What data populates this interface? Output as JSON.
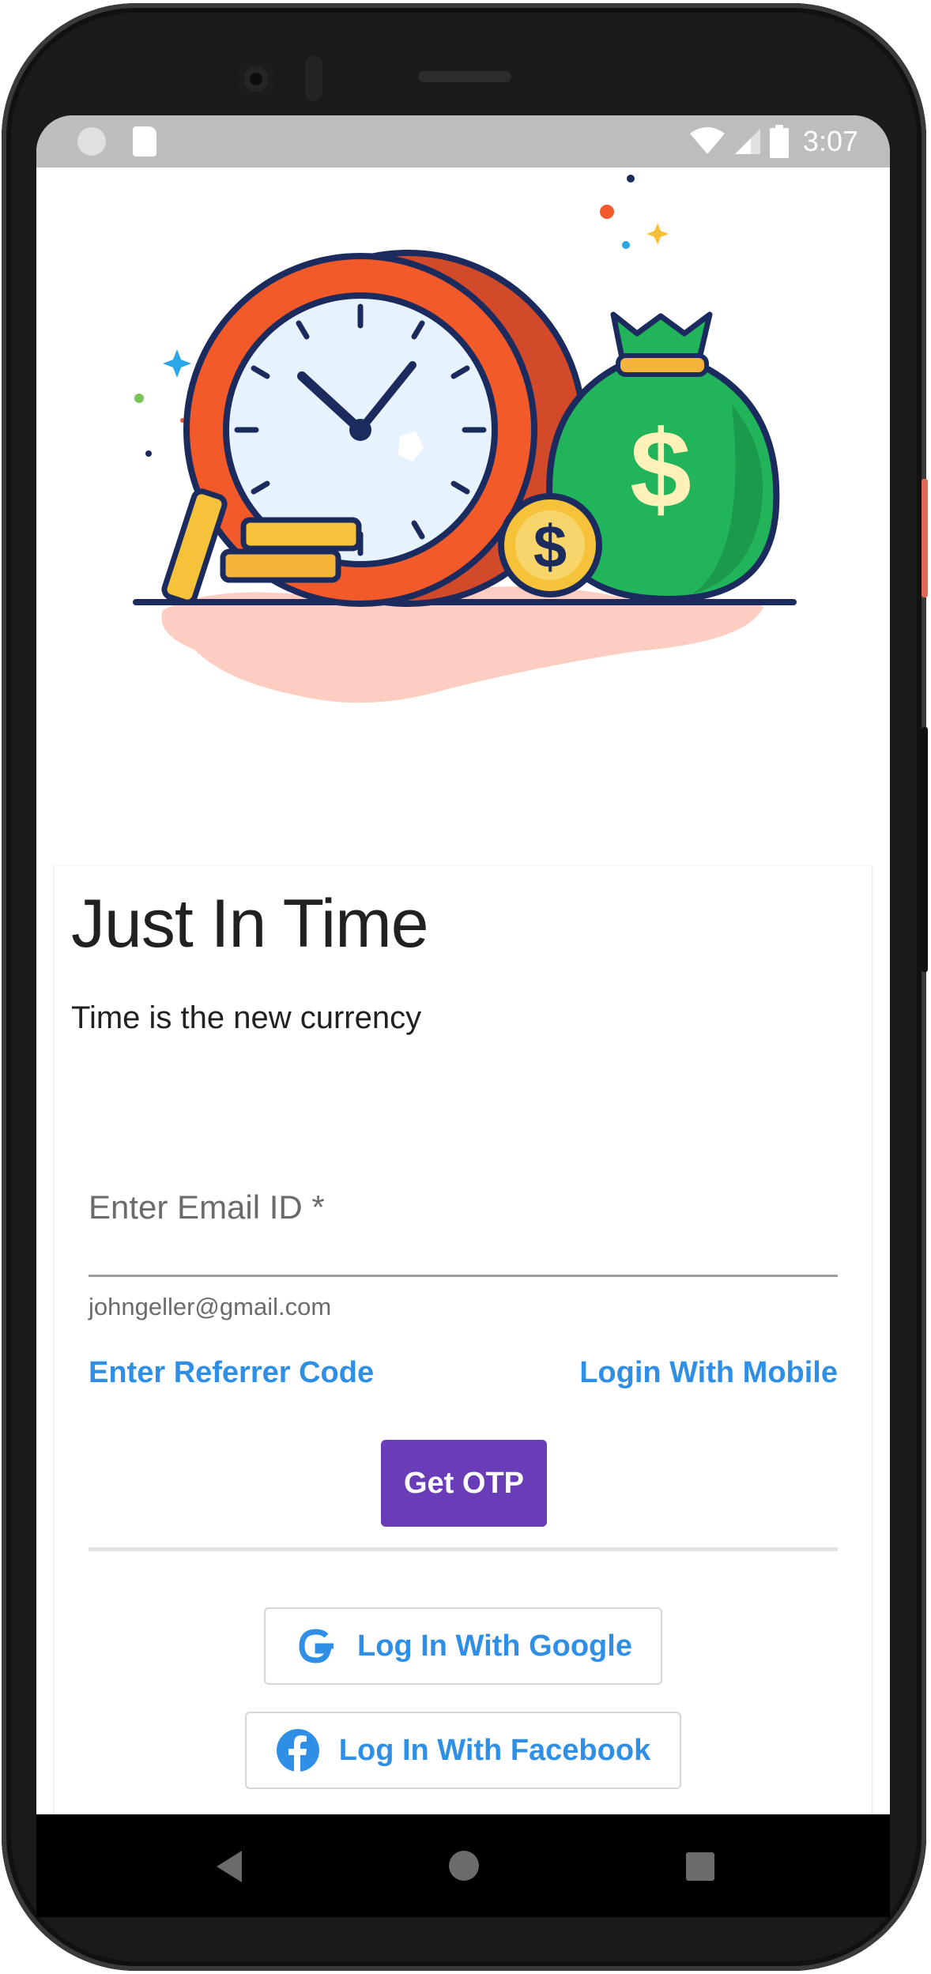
{
  "status_bar": {
    "time": "3:07"
  },
  "app": {
    "title": "Just In Time",
    "subtitle": "Time is the new currency"
  },
  "form": {
    "email_label": "Enter Email ID *",
    "email_value": "",
    "email_helper": "johngeller@gmail.com",
    "referrer_link": "Enter Referrer Code",
    "mobile_link": "Login With Mobile",
    "otp_button": "Get OTP"
  },
  "social": {
    "google_label": "Log In With Google",
    "facebook_label": "Log In With Facebook"
  },
  "colors": {
    "accent_purple": "#6a3db8",
    "link_blue": "#2f8fe6",
    "clock_orange": "#f25a2a",
    "bag_green": "#22b45a"
  },
  "icons": {
    "status_left": [
      "notification-dot-icon",
      "sd-card-icon"
    ],
    "status_right": [
      "wifi-icon",
      "cell-signal-icon",
      "battery-icon"
    ],
    "illustration": [
      "clock-icon",
      "money-bag-icon",
      "coin-icon"
    ],
    "nav": [
      "back-icon",
      "home-icon",
      "recents-icon"
    ]
  }
}
